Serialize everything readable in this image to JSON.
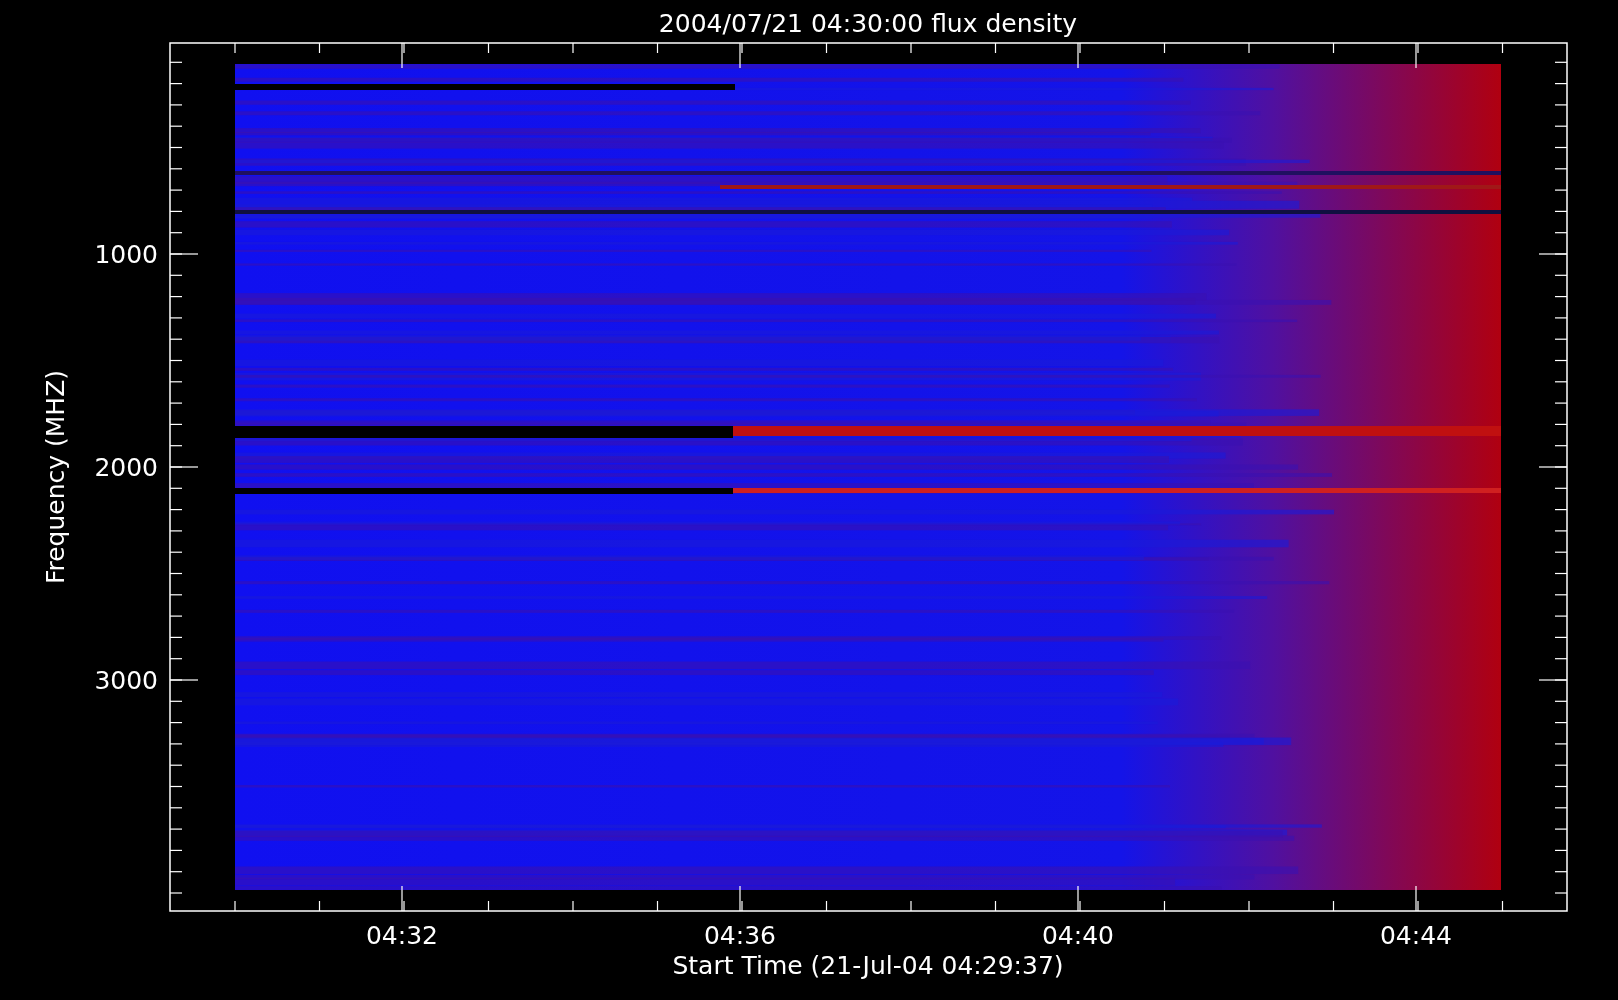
{
  "plot": {
    "title": "2004/07/21 04:30:00 flux density",
    "xlabel": "Start Time (21-Jul-04 04:29:37)",
    "ylabel": "Frequency (MHZ)",
    "xticks": [
      "04:32",
      "04:36",
      "04:40",
      "04:44"
    ],
    "yticks": [
      "1000",
      "2000",
      "3000"
    ]
  }
}
